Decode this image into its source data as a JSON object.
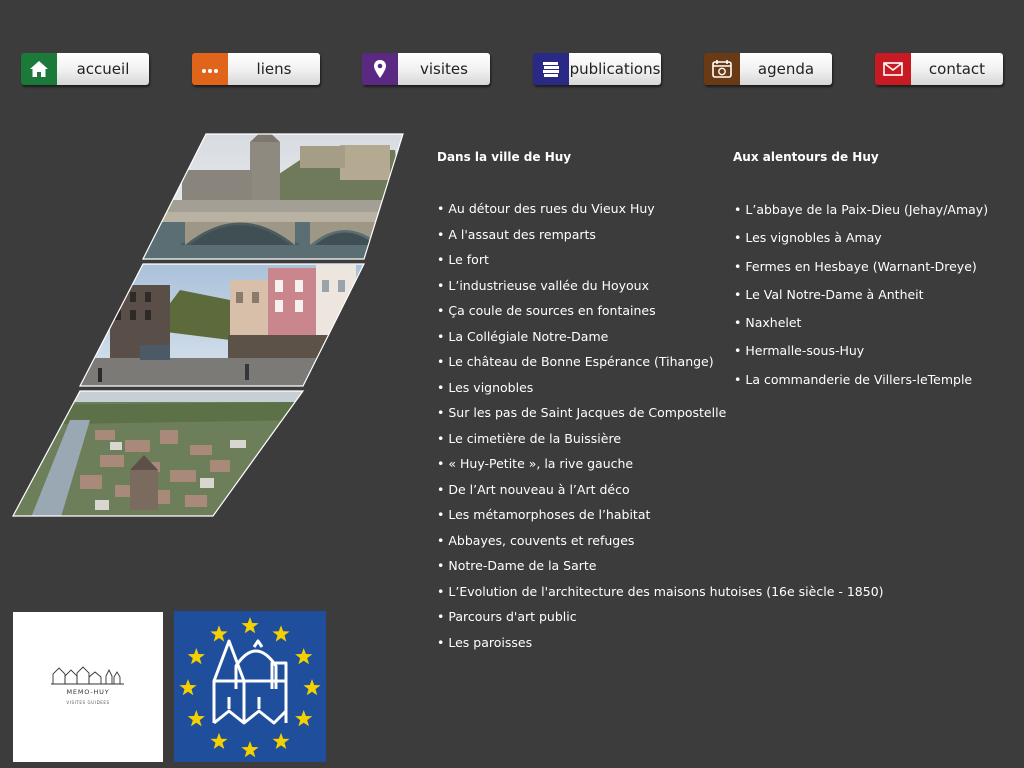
{
  "nav": [
    {
      "key": "accueil",
      "label": "accueil",
      "color": "#1b7a3a",
      "icon": "home-icon"
    },
    {
      "key": "liens",
      "label": "liens",
      "color": "#e0651a",
      "icon": "ellipsis-icon"
    },
    {
      "key": "visites",
      "label": "visites",
      "color": "#5a2a82",
      "icon": "map-pin-icon"
    },
    {
      "key": "publications",
      "label": "publications",
      "color": "#2a2a86",
      "icon": "books-icon"
    },
    {
      "key": "agenda",
      "label": "agenda",
      "color": "#6a3a14",
      "icon": "calendar-icon"
    },
    {
      "key": "contact",
      "label": "contact",
      "color": "#c81a22",
      "icon": "envelope-icon"
    }
  ],
  "columns": {
    "huy": {
      "title": "Dans la ville de Huy",
      "items": [
        "Au détour des rues du Vieux Huy",
        "A l'assaut des remparts",
        "Le fort",
        "L’industrieuse vallée du Hoyoux",
        "Ça coule de sources en fontaines",
        "La Collégiale Notre-Dame",
        "Le château de Bonne Espérance (Tihange)",
        "Les vignobles",
        "Sur les pas de Saint Jacques de Compostelle",
        "Le cimetière de la Buissière",
        "« Huy-Petite », la rive gauche",
        "De l’Art nouveau à l’Art déco",
        "Les métamorphoses de l’habitat",
        "Abbayes, couvents et refuges",
        "Notre-Dame de la Sarte",
        "L’Evolution de l'architecture des maisons hutoises (16e siècle - 1850)",
        "Parcours d'art public",
        "Les paroisses"
      ]
    },
    "around": {
      "title": "Aux alentours de Huy",
      "items": [
        "L’abbaye de la Paix-Dieu (Jehay/Amay)",
        "Les vignobles à Amay",
        "Fermes en Hesbaye (Warnant-Dreye)",
        "Le Val Notre-Dame à Antheit",
        "Naxhelet",
        "Hermalle-sous-Huy",
        "La commanderie de Villers-leTemple"
      ]
    }
  },
  "bullet": "•",
  "logos": {
    "memo_name": "MEMO-HUY",
    "memo_sub": "VISITES GUIDEES"
  },
  "colors": {
    "background": "#3c3c3c",
    "eu_blue": "#1e4e9c",
    "eu_star": "#f5d000"
  }
}
